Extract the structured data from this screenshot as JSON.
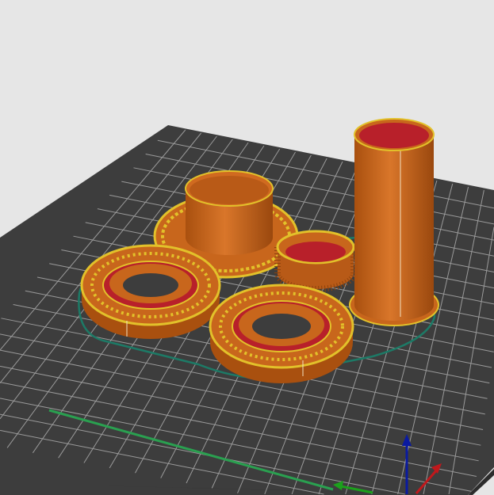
{
  "viewport": {
    "background_color": "#e6e6e6",
    "bed_color": "#3d3d3d",
    "grid_color": "#9a9a9a",
    "object_color": "#c8661c",
    "infill_color": "#b8202a",
    "perimeter_color": "#e2c12a",
    "skirt_color": "#1d7a66",
    "axis_colors": {
      "x": "#c0181c",
      "y": "#1ca01c",
      "z": "#0a1aa0"
    }
  }
}
